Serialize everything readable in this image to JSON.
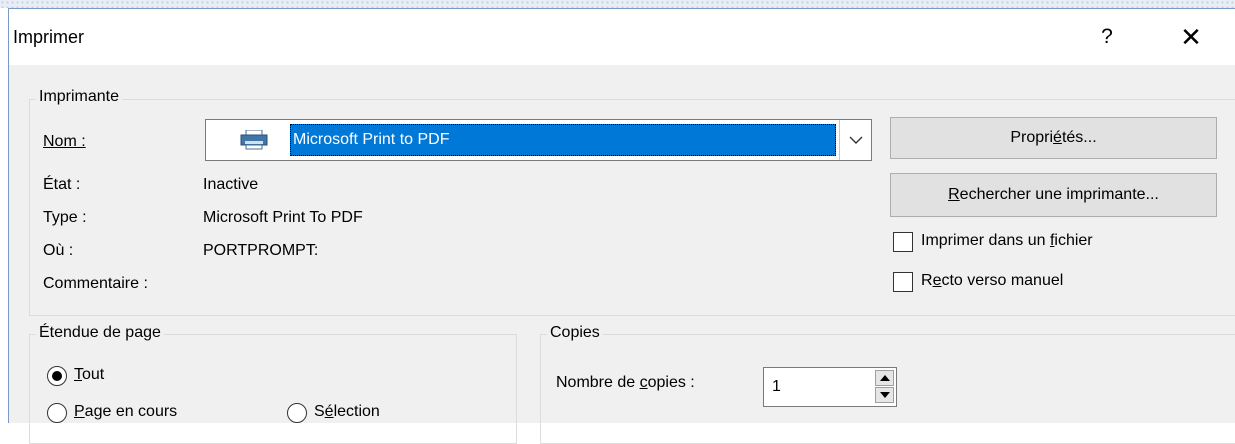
{
  "window": {
    "title": "Imprimer",
    "help": "?",
    "close": "✕"
  },
  "printer": {
    "group_label": "Imprimante",
    "name_label": "Nom :",
    "name_value": "Microsoft Print to PDF",
    "status_label": "État :",
    "status_value": "Inactive",
    "type_label": "Type :",
    "type_value": "Microsoft Print To PDF",
    "where_label": "Où :",
    "where_value": "PORTPROMPT:",
    "comment_label": "Commentaire :",
    "properties_prefix": "Propri",
    "properties_accel": "é",
    "properties_suffix": "tés...",
    "find_accel": "R",
    "find_suffix": "echercher une imprimante...",
    "print_to_file_prefix": "Imprimer dans un ",
    "print_to_file_accel": "f",
    "print_to_file_suffix": "ichier",
    "print_to_file_checked": false,
    "duplex_prefix": "R",
    "duplex_accel": "e",
    "duplex_suffix": "cto verso manuel",
    "duplex_checked": false,
    "icon": "printer-icon"
  },
  "page_range": {
    "group_label": "Étendue de page",
    "all_accel": "T",
    "all_suffix": "out",
    "all_selected": true,
    "current_accel": "P",
    "current_suffix": "age en cours",
    "selection_prefix": "S",
    "selection_accel": "é",
    "selection_suffix": "lection"
  },
  "copies": {
    "group_label": "Copies",
    "count_prefix": "Nombre de ",
    "count_accel": "c",
    "count_suffix": "opies :",
    "count_value": "1"
  },
  "colors": {
    "selection": "#0078d7",
    "dialog_bg": "#f0f0f0",
    "button_bg": "#e1e1e1",
    "window_border": "#7a99c6"
  }
}
